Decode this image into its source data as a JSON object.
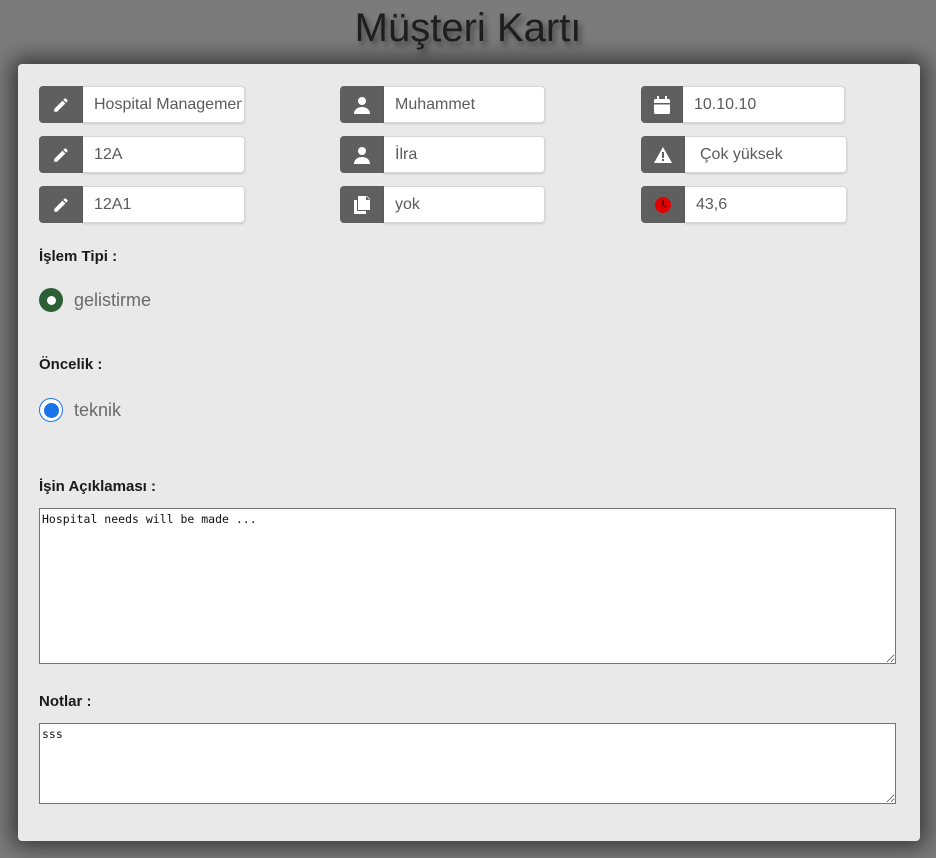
{
  "page": {
    "title": "Müşteri Kartı"
  },
  "fields": {
    "col1": [
      {
        "icon": "pencil-icon",
        "value": "Hospital Management"
      },
      {
        "icon": "pencil-icon",
        "value": "12A"
      },
      {
        "icon": "pencil-icon",
        "value": "12A1"
      }
    ],
    "col2": [
      {
        "icon": "user-icon",
        "value": "Muhammet"
      },
      {
        "icon": "user-icon",
        "value": "İlra"
      },
      {
        "icon": "copy-icon",
        "value": "yok"
      }
    ],
    "col3": [
      {
        "icon": "calendar-icon",
        "value": "10.10.10"
      },
      {
        "icon": "warning-icon",
        "value": "Çok yüksek"
      },
      {
        "icon": "clock-icon",
        "value": "43,6"
      }
    ]
  },
  "islem_tipi": {
    "label": "İşlem Tipi :",
    "option": "gelistirme"
  },
  "oncelik": {
    "label": "Öncelik :",
    "option": "teknik"
  },
  "aciklama": {
    "label": "İşin Açıklaması :",
    "value": "Hospital needs will be made ..."
  },
  "notlar": {
    "label": "Notlar :",
    "value": "sss"
  },
  "colors": {
    "background": "#7b7b7b",
    "card": "#e9e9e9",
    "icon_box": "#5f5f5f",
    "radio_green": "#2c5f36",
    "radio_blue": "#1a73e8",
    "clock_red": "#e00000"
  }
}
